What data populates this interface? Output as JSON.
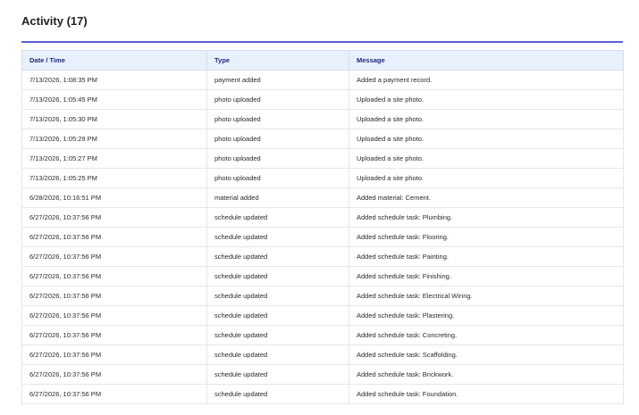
{
  "activity": {
    "title": "Activity (17)",
    "columns": {
      "datetime": "Date / Time",
      "type": "Type",
      "message": "Message"
    },
    "rows": [
      {
        "datetime": "7/13/2026, 1:08:35 PM",
        "type": "payment added",
        "message": "Added a payment record."
      },
      {
        "datetime": "7/13/2026, 1:05:45 PM",
        "type": "photo uploaded",
        "message": "Uploaded a site photo."
      },
      {
        "datetime": "7/13/2026, 1:05:30 PM",
        "type": "photo uploaded",
        "message": "Uploaded a site photo."
      },
      {
        "datetime": "7/13/2026, 1:05:29 PM",
        "type": "photo uploaded",
        "message": "Uploaded a site photo."
      },
      {
        "datetime": "7/13/2026, 1:05:27 PM",
        "type": "photo uploaded",
        "message": "Uploaded a site photo."
      },
      {
        "datetime": "7/13/2026, 1:05:25 PM",
        "type": "photo uploaded",
        "message": "Uploaded a site photo."
      },
      {
        "datetime": "6/28/2026, 10:16:51 PM",
        "type": "material added",
        "message": "Added material: Cement."
      },
      {
        "datetime": "6/27/2026, 10:37:56 PM",
        "type": "schedule updated",
        "message": "Added schedule task: Plumbing."
      },
      {
        "datetime": "6/27/2026, 10:37:56 PM",
        "type": "schedule updated",
        "message": "Added schedule task: Flooring."
      },
      {
        "datetime": "6/27/2026, 10:37:56 PM",
        "type": "schedule updated",
        "message": "Added schedule task: Painting."
      },
      {
        "datetime": "6/27/2026, 10:37:56 PM",
        "type": "schedule updated",
        "message": "Added schedule task: Finishing."
      },
      {
        "datetime": "6/27/2026, 10:37:56 PM",
        "type": "schedule updated",
        "message": "Added schedule task: Electrical Wiring."
      },
      {
        "datetime": "6/27/2026, 10:37:56 PM",
        "type": "schedule updated",
        "message": "Added schedule task: Plastering."
      },
      {
        "datetime": "6/27/2026, 10:37:56 PM",
        "type": "schedule updated",
        "message": "Added schedule task: Concreting."
      },
      {
        "datetime": "6/27/2026, 10:37:56 PM",
        "type": "schedule updated",
        "message": "Added schedule task: Scaffolding."
      },
      {
        "datetime": "6/27/2026, 10:37:56 PM",
        "type": "schedule updated",
        "message": "Added schedule task: Brickwork."
      },
      {
        "datetime": "6/27/2026, 10:37:56 PM",
        "type": "schedule updated",
        "message": "Added schedule task: Foundation."
      }
    ]
  },
  "colors": {
    "accent_rule": "#5a5fd6",
    "header_bg": "#e8f0fb",
    "header_text": "#1d2a7a"
  }
}
